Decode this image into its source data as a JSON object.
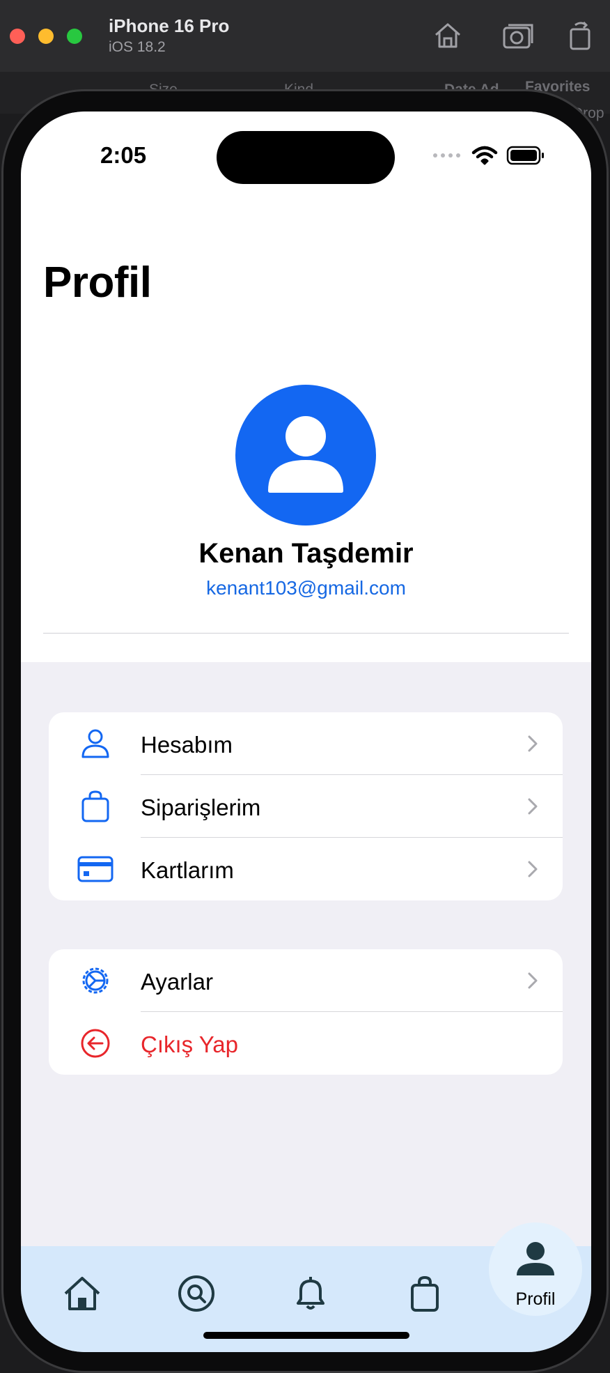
{
  "simulator": {
    "device_name": "iPhone 16 Pro",
    "os_version": "iOS 18.2"
  },
  "background_window": {
    "columns": [
      "Size",
      "Kind",
      "Date Ad"
    ],
    "sidebar": [
      "Favorites",
      "Drop"
    ]
  },
  "status_bar": {
    "time": "2:05"
  },
  "page": {
    "title": "Profil"
  },
  "profile": {
    "name": "Kenan Taşdemir",
    "email": "kenant103@gmail.com"
  },
  "menu_groups": [
    {
      "items": [
        {
          "label": "Hesabım",
          "icon": "person-icon"
        },
        {
          "label": "Siparişlerim",
          "icon": "bag-icon"
        },
        {
          "label": "Kartlarım",
          "icon": "credit-card-icon"
        }
      ]
    },
    {
      "items": [
        {
          "label": "Ayarlar",
          "icon": "gear-icon"
        },
        {
          "label": "Çıkış Yap",
          "icon": "logout-icon",
          "color": "#e8262b"
        }
      ]
    }
  ],
  "tab_bar": {
    "tabs": [
      {
        "icon": "home-icon"
      },
      {
        "icon": "search-icon"
      },
      {
        "icon": "bell-icon"
      },
      {
        "icon": "bag-icon"
      },
      {
        "icon": "profile-icon",
        "label": "Profil",
        "selected": true
      }
    ]
  },
  "colors": {
    "accent": "#1367f2",
    "danger": "#e8262b",
    "tab_bar": "#d5e8fb",
    "grouped_background": "#f0eff5"
  }
}
